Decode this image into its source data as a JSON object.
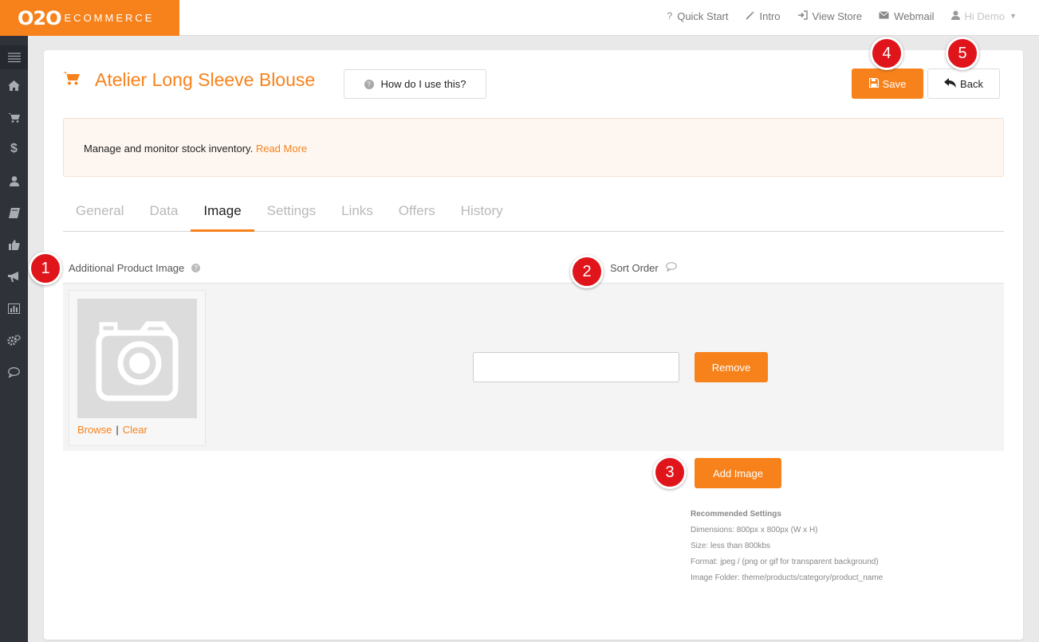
{
  "logo": {
    "o2o": "O2O",
    "ecommerce": "ECOMMERCE"
  },
  "topnav": {
    "quick_start": "Quick Start",
    "intro": "Intro",
    "view_store": "View Store",
    "webmail": "Webmail",
    "user": "Hi Demo"
  },
  "sidebar": {
    "items": [
      "menu-icon",
      "home-icon",
      "cart-icon",
      "dollar-icon",
      "user-icon",
      "book-icon",
      "thumbs-up-icon",
      "megaphone-icon",
      "bar-chart-icon",
      "cogs-icon",
      "comment-icon"
    ]
  },
  "page": {
    "title": "Atelier Long Sleeve Blouse",
    "help_button": "How do I use this?",
    "save_button": "Save",
    "back_button": "Back"
  },
  "info": {
    "text": "Manage and monitor stock inventory.",
    "read_more": "Read More"
  },
  "tabs": [
    {
      "label": "General",
      "active": false
    },
    {
      "label": "Data",
      "active": false
    },
    {
      "label": "Image",
      "active": true
    },
    {
      "label": "Settings",
      "active": false
    },
    {
      "label": "Links",
      "active": false
    },
    {
      "label": "Offers",
      "active": false
    },
    {
      "label": "History",
      "active": false
    }
  ],
  "image_section": {
    "additional_label": "Additional Product Image",
    "sort_order_label": "Sort Order",
    "browse": "Browse",
    "separator": "|",
    "clear": "Clear",
    "sort_order_value": "",
    "remove_button": "Remove",
    "add_button": "Add Image"
  },
  "recommended": {
    "heading": "Recommended Settings",
    "dimensions": "Dimensions: 800px x 800px (W x H)",
    "size": "Size: less than 800kbs",
    "format": "Format: jpeg / (png or gif for transparent background)",
    "folder": "Image Folder: theme/products/category/product_name"
  },
  "markers": [
    "1",
    "2",
    "3",
    "4",
    "5"
  ],
  "colors": {
    "accent": "#f7821b",
    "marker": "#e0151b",
    "sidebar": "#2f3239"
  }
}
